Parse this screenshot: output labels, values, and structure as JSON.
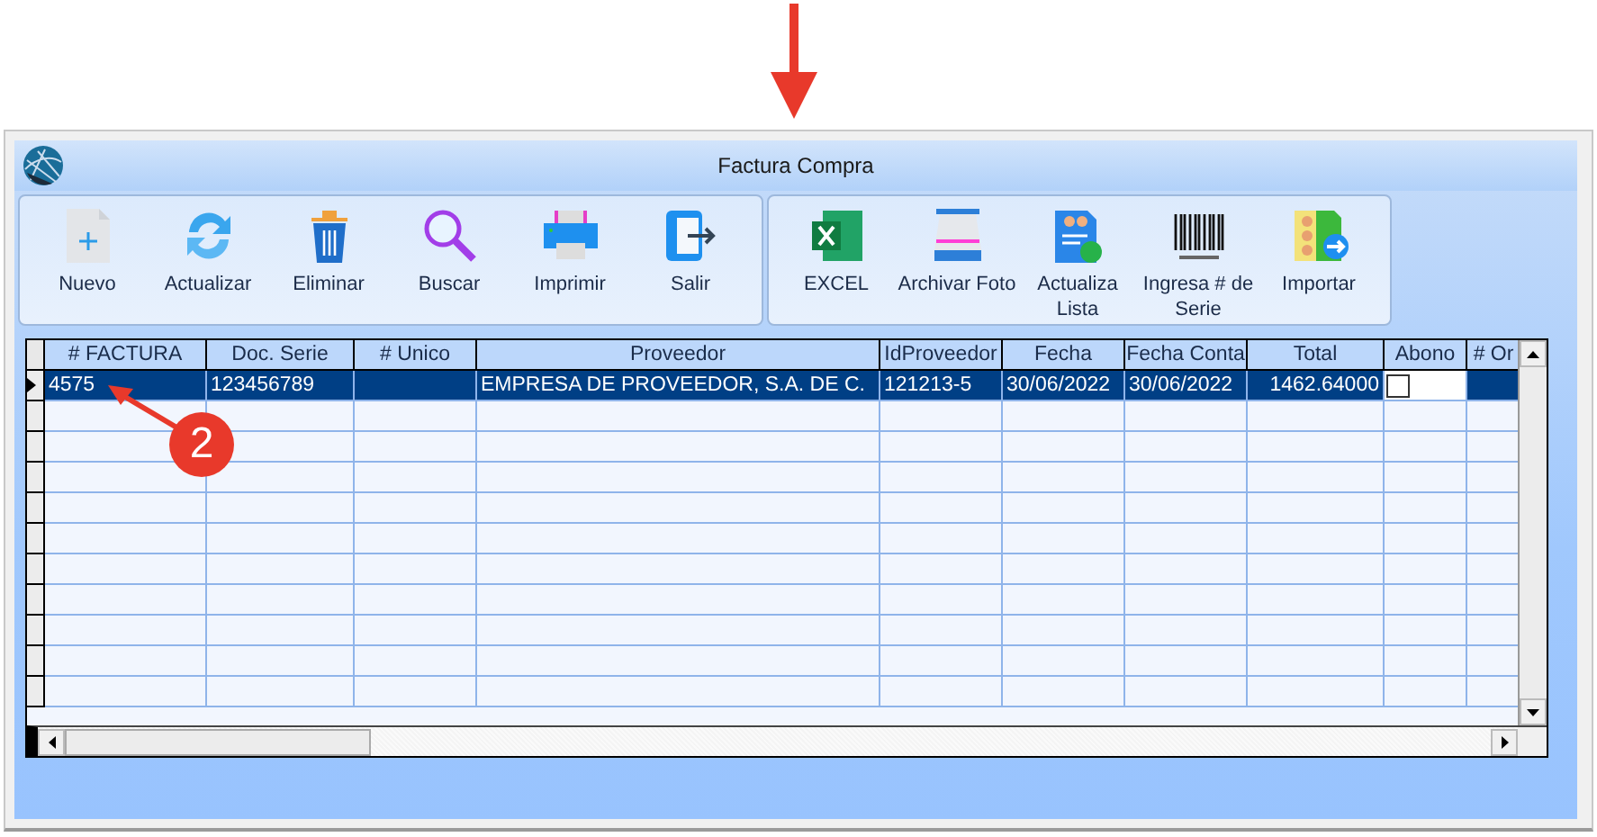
{
  "window": {
    "title": "Factura Compra"
  },
  "toolbar": {
    "groups": [
      {
        "buttons": [
          {
            "label": "Nuevo"
          },
          {
            "label": "Actualizar"
          },
          {
            "label": "Eliminar"
          },
          {
            "label": "Buscar"
          },
          {
            "label": "Imprimir"
          },
          {
            "label": "Salir"
          }
        ]
      },
      {
        "buttons": [
          {
            "label": "EXCEL"
          },
          {
            "label": "Archivar Foto"
          },
          {
            "label": "Actualiza Lista"
          },
          {
            "label": "Ingresa # de Serie"
          },
          {
            "label": "Importar"
          }
        ]
      }
    ]
  },
  "table": {
    "columns": [
      "# FACTURA",
      "Doc. Serie",
      "# Unico",
      "Proveedor",
      "IdProveedor",
      "Fecha",
      "Fecha Conta",
      "Total",
      "Abono",
      "# Or"
    ],
    "rows": [
      {
        "selected": true,
        "cells": [
          "4575",
          "123456789",
          "",
          "EMPRESA DE PROVEEDOR, S.A. DE C.",
          "121213-5",
          "30/06/2022",
          "30/06/2022",
          "1462.64000",
          "",
          "",
          ""
        ],
        "abono_checked": false
      }
    ]
  },
  "annotation": {
    "label": "2"
  }
}
